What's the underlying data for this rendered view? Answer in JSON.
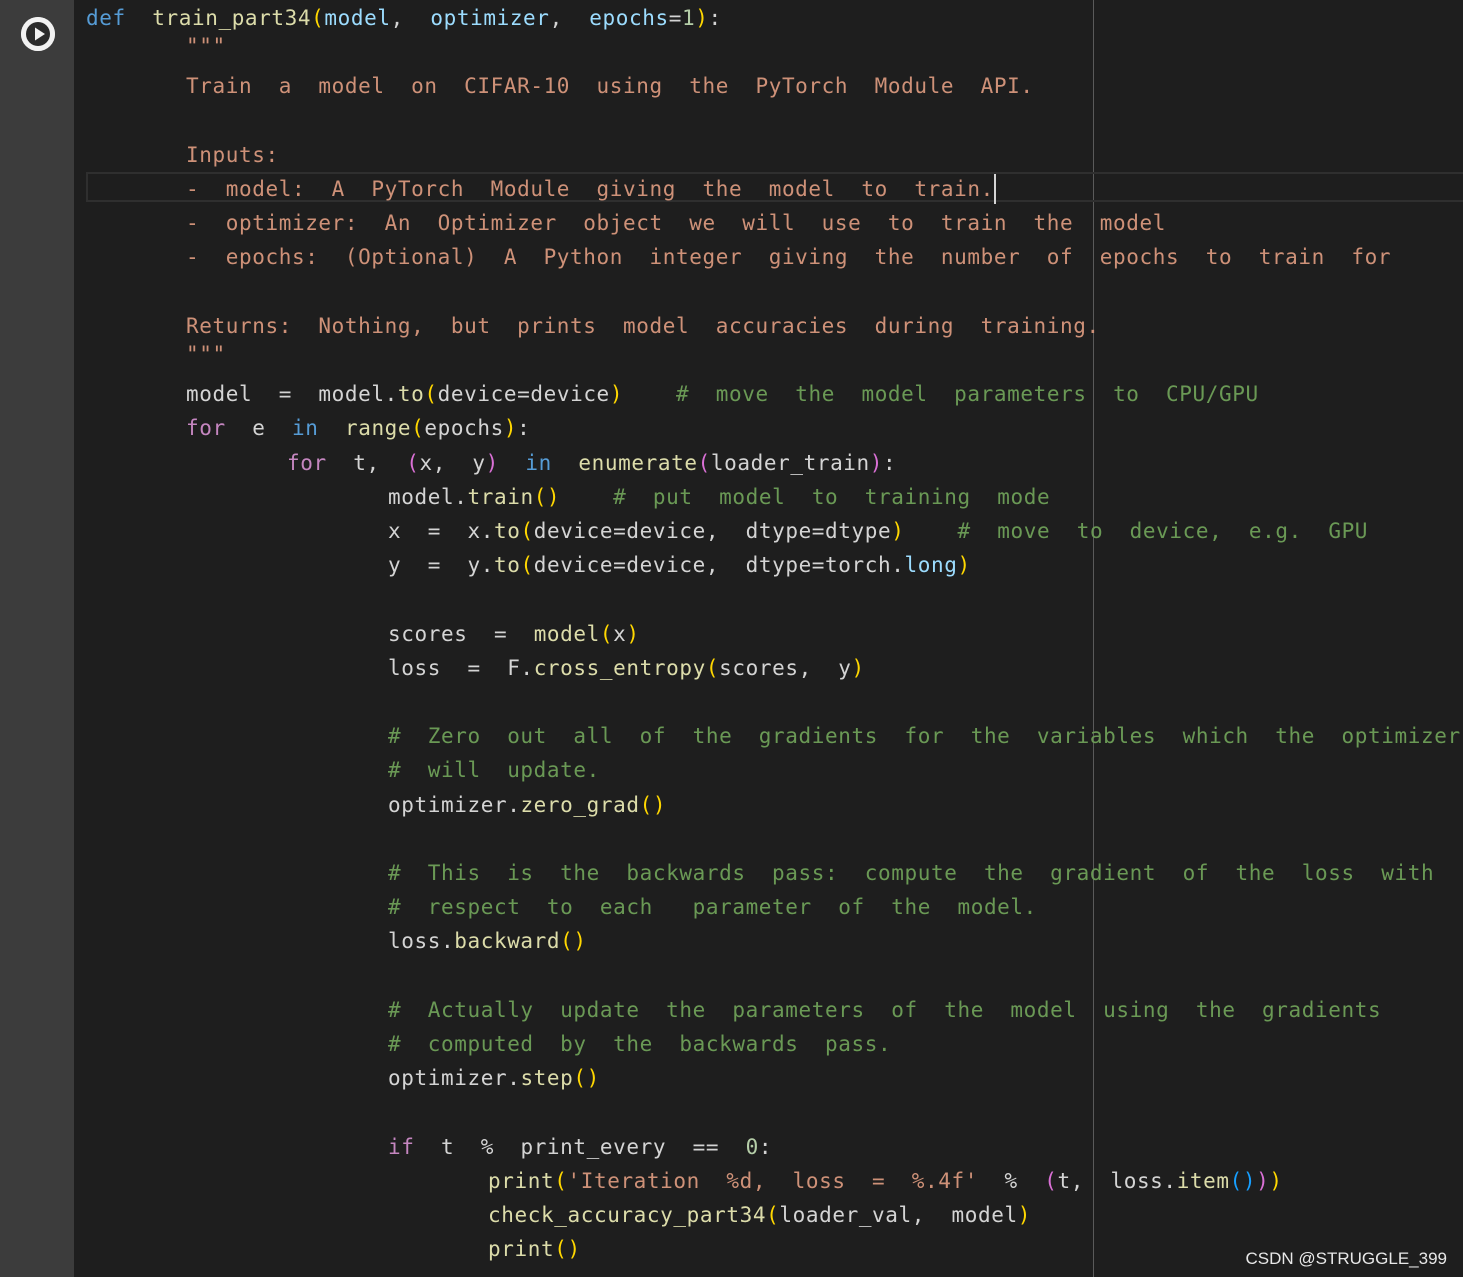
{
  "cell": {
    "run_button_label": "Run cell",
    "colors": {
      "background": "#1e1e1e",
      "gutter": "#3c3c3c",
      "keyword": "#569cd6",
      "control": "#c586c0",
      "function": "#dcdcaa",
      "parameter": "#9cdcfe",
      "string": "#ce9178",
      "comment": "#6a9955",
      "bracket": "#ffd700"
    }
  },
  "code": {
    "def_kw": "def",
    "fn_name": "train_part34",
    "p_model": "model",
    "p_optimizer": "optimizer",
    "p_epochs": "epochs",
    "p_default": "1",
    "doc_open": "\"\"\"",
    "doc_desc": "Train  a  model  on  CIFAR-10  using  the  PyTorch  Module  API.",
    "doc_inputs": "Inputs:",
    "doc_in_model": "-  model:  A  PyTorch  Module  giving  the  model  to  train.",
    "doc_in_optimizer": "-  optimizer:  An  Optimizer  object  we  will  use  to  train  the  model",
    "doc_in_epochs": "-  epochs:  (Optional)  A  Python  integer  giving  the  number  of  epochs  to  train  for",
    "doc_returns": "Returns:  Nothing,  but  prints  model  accuracies  during  training.",
    "doc_close": "\"\"\"",
    "l_model_to_a": "model  =  model.",
    "l_model_to_fn": "to",
    "l_model_to_b": "device=device",
    "l_model_to_com": "#  move  the  model  parameters  to  CPU/GPU",
    "for_kw": "for",
    "for_var": "  e  ",
    "in_kw": "in",
    "range_fn": "range",
    "range_arg": "epochs",
    "for2_vars_a": "  t,  ",
    "for2_vars_b": "x,  y",
    "enumerate_fn": "enumerate",
    "enumerate_arg": "loader_train",
    "train_a": "model.",
    "train_fn": "train",
    "train_com": "#  put  model  to  training  mode",
    "x_a": "x  =  x.",
    "x_fn": "to",
    "x_args": "device=device,  dtype=dtype",
    "x_com": "#  move  to  device,  e.g.  GPU",
    "y_a": "y  =  y.",
    "y_fn": "to",
    "y_args_a": "device=device,  dtype=torch.",
    "y_long": "long",
    "scores_a": "scores  =  ",
    "scores_fn": "model",
    "scores_arg": "x",
    "loss_a": "loss  =  F.",
    "loss_fn": "cross_entropy",
    "loss_args": "scores,  y",
    "com_zero_1": "#  Zero  out  all  of  the  gradients  for  the  variables  which  the  optimizer",
    "com_zero_2": "#  will  update.",
    "zero_a": "optimizer.",
    "zero_fn": "zero_grad",
    "com_back_1": "#  This  is  the  backwards  pass:  compute  the  gradient  of  the  loss  with",
    "com_back_2": "#  respect  to  each   parameter  of  the  model.",
    "back_a": "loss.",
    "back_fn": "backward",
    "com_upd_1": "#  Actually  update  the  parameters  of  the  model  using  the  gradients",
    "com_upd_2": "#  computed  by  the  backwards  pass.",
    "step_a": "optimizer.",
    "step_fn": "step",
    "if_kw": "if",
    "if_cond": "  t  %  print_every  ==  ",
    "if_zero": "0",
    "print_fn": "print",
    "print_str": "'Iteration  %d,  loss  =  %.4f'",
    "print_mod": "  %  ",
    "print_args_a": "t,  loss.",
    "item_fn": "item",
    "check_fn": "check_accuracy_part34",
    "check_args": "loader_val,  model",
    "print2_fn": "print"
  },
  "watermark": "CSDN @STRUGGLE_399"
}
